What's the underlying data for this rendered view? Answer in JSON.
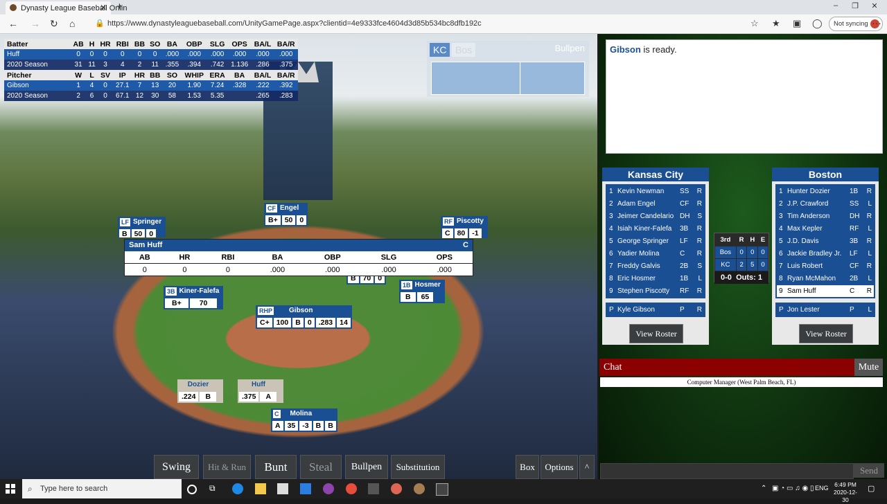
{
  "browser": {
    "tab_title": "Dynasty League Baseball Onlin",
    "tab_close": "✕",
    "new_tab": "+",
    "url": "https://www.dynastyleaguebaseball.com/UnityGamePage.aspx?clientid=4e9333fce4604d3d85b534bc8dfb192c",
    "sync_label": "Not syncing",
    "more": "···"
  },
  "stats_table": {
    "batter_header": [
      "Batter",
      "AB",
      "H",
      "HR",
      "RBI",
      "BB",
      "SO",
      "BA",
      "OBP",
      "SLG",
      "OPS",
      "BA/L",
      "BA/R"
    ],
    "batter_rows": [
      [
        "Huff",
        "0",
        "0",
        "0",
        "0",
        "0",
        "0",
        ".000",
        ".000",
        ".000",
        ".000",
        ".000",
        ".000"
      ],
      [
        "2020 Season",
        "31",
        "11",
        "3",
        "4",
        "2",
        "11",
        ".355",
        ".394",
        ".742",
        "1.136",
        ".286",
        ".375"
      ]
    ],
    "pitcher_header": [
      "Pitcher",
      "W",
      "L",
      "SV",
      "IP",
      "HR",
      "BB",
      "SO",
      "WHIP",
      "ERA",
      "BA",
      "BA/L",
      "BA/R"
    ],
    "pitcher_rows": [
      [
        "Gibson",
        "1",
        "4",
        "0",
        "27.1",
        "7",
        "13",
        "20",
        "1.90",
        "7.24",
        ".328",
        ".222",
        ".392"
      ],
      [
        "2020 Season",
        "2",
        "6",
        "0",
        "67.1",
        "12",
        "30",
        "58",
        "1.53",
        "5.35",
        "",
        ".265",
        ".283"
      ]
    ]
  },
  "bullpen_panel": {
    "kc": "KC",
    "bos": "Bos",
    "title": "Bullpen"
  },
  "fielders": {
    "cf": {
      "pos": "CF",
      "name": "Engel",
      "grade": "B+",
      "v1": "50",
      "v2": "0"
    },
    "lf": {
      "pos": "LF",
      "name": "Springer",
      "grade": "B",
      "v1": "50",
      "v2": "0"
    },
    "rf": {
      "pos": "RF",
      "name": "Piscotty",
      "grade": "C",
      "v1": "80",
      "v2": "-1"
    },
    "third": {
      "pos": "3B",
      "name": "Kiner-Falefa",
      "grade": "B+",
      "v1": "70"
    },
    "first": {
      "pos": "1B",
      "name": "Hosmer",
      "grade": "B",
      "v1": "65"
    },
    "ss_partial": {
      "v1": "B",
      "v2": "70",
      "v3": "0"
    },
    "pitcher": {
      "pos": "RHP",
      "name": "Gibson",
      "c1": "C+",
      "c2": "100",
      "c3": "B",
      "c4": "0",
      "c5": ".283",
      "c6": "14"
    },
    "catcher": {
      "pos": "C",
      "name": "Molina",
      "c1": "A",
      "c2": "35",
      "c3": "-3",
      "c4": "B",
      "c5": "B"
    },
    "on_deck": {
      "name": "Dozier",
      "avg": ".224",
      "grade": "B"
    },
    "batter": {
      "name": "Huff",
      "avg": ".375",
      "grade": "A"
    }
  },
  "popup": {
    "name": "Sam Huff",
    "pos": "C",
    "headers": [
      "AB",
      "HR",
      "RBI",
      "BA",
      "OBP",
      "SLG",
      "OPS"
    ],
    "values": [
      "0",
      "0",
      "0",
      ".000",
      ".000",
      ".000",
      ".000"
    ]
  },
  "game_buttons": {
    "swing": "Swing",
    "hit_run": "Hit & Run",
    "bunt": "Bunt",
    "steal": "Steal",
    "bullpen": "Bullpen",
    "substitution": "Substitution",
    "box": "Box",
    "options": "Options",
    "up": "^"
  },
  "message": {
    "name": "Gibson",
    "text": " is ready."
  },
  "teams": {
    "home": {
      "name": "Kansas City",
      "lineup": [
        {
          "o": "1",
          "name": "Kevin Newman",
          "pos": "SS",
          "hand": "R"
        },
        {
          "o": "2",
          "name": "Adam Engel",
          "pos": "CF",
          "hand": "R"
        },
        {
          "o": "3",
          "name": "Jeimer Candelario",
          "pos": "DH",
          "hand": "S"
        },
        {
          "o": "4",
          "name": "Isiah Kiner-Falefa",
          "pos": "3B",
          "hand": "R"
        },
        {
          "o": "5",
          "name": "George Springer",
          "pos": "LF",
          "hand": "R"
        },
        {
          "o": "6",
          "name": "Yadier Molina",
          "pos": "C",
          "hand": "R"
        },
        {
          "o": "7",
          "name": "Freddy Galvis",
          "pos": "2B",
          "hand": "S"
        },
        {
          "o": "8",
          "name": "Eric Hosmer",
          "pos": "1B",
          "hand": "L"
        },
        {
          "o": "9",
          "name": "Stephen Piscotty",
          "pos": "RF",
          "hand": "R"
        }
      ],
      "pitcher": {
        "o": "P",
        "name": "Kyle Gibson",
        "pos": "P",
        "hand": "R"
      },
      "view_roster": "View Roster"
    },
    "away": {
      "name": "Boston",
      "lineup": [
        {
          "o": "1",
          "name": "Hunter Dozier",
          "pos": "1B",
          "hand": "R"
        },
        {
          "o": "2",
          "name": "J.P. Crawford",
          "pos": "SS",
          "hand": "L"
        },
        {
          "o": "3",
          "name": "Tim Anderson",
          "pos": "DH",
          "hand": "R"
        },
        {
          "o": "4",
          "name": "Max Kepler",
          "pos": "RF",
          "hand": "L"
        },
        {
          "o": "5",
          "name": "J.D. Davis",
          "pos": "3B",
          "hand": "R"
        },
        {
          "o": "6",
          "name": "Jackie Bradley Jr.",
          "pos": "LF",
          "hand": "L"
        },
        {
          "o": "7",
          "name": "Luis Robert",
          "pos": "CF",
          "hand": "R"
        },
        {
          "o": "8",
          "name": "Ryan McMahon",
          "pos": "2B",
          "hand": "L"
        },
        {
          "o": "9",
          "name": "Sam Huff",
          "pos": "C",
          "hand": "R"
        }
      ],
      "pitcher": {
        "o": "P",
        "name": "Jon Lester",
        "pos": "P",
        "hand": "L"
      },
      "view_roster": "View Roster"
    }
  },
  "linescore": {
    "inning": "3rd",
    "cols": [
      "R",
      "H",
      "E"
    ],
    "rows": [
      {
        "team": "Bos",
        "r": "0",
        "h": "0",
        "e": "0"
      },
      {
        "team": "KC",
        "r": "2",
        "h": "5",
        "e": "0"
      }
    ],
    "count": "0-0",
    "outs": "Outs: 1"
  },
  "chat": {
    "title": "Chat",
    "mute": "Mute",
    "system": "Computer Manager (West Palm Beach, FL)",
    "send": "Send"
  },
  "taskbar": {
    "search": "Type here to search",
    "lang": "ENG",
    "time": "6:49 PM",
    "date": "2020-12-30"
  },
  "colors": {
    "team_blue": "#1b4f94",
    "chat_red": "#8b0000",
    "panel_green": "#0e2f0e"
  }
}
